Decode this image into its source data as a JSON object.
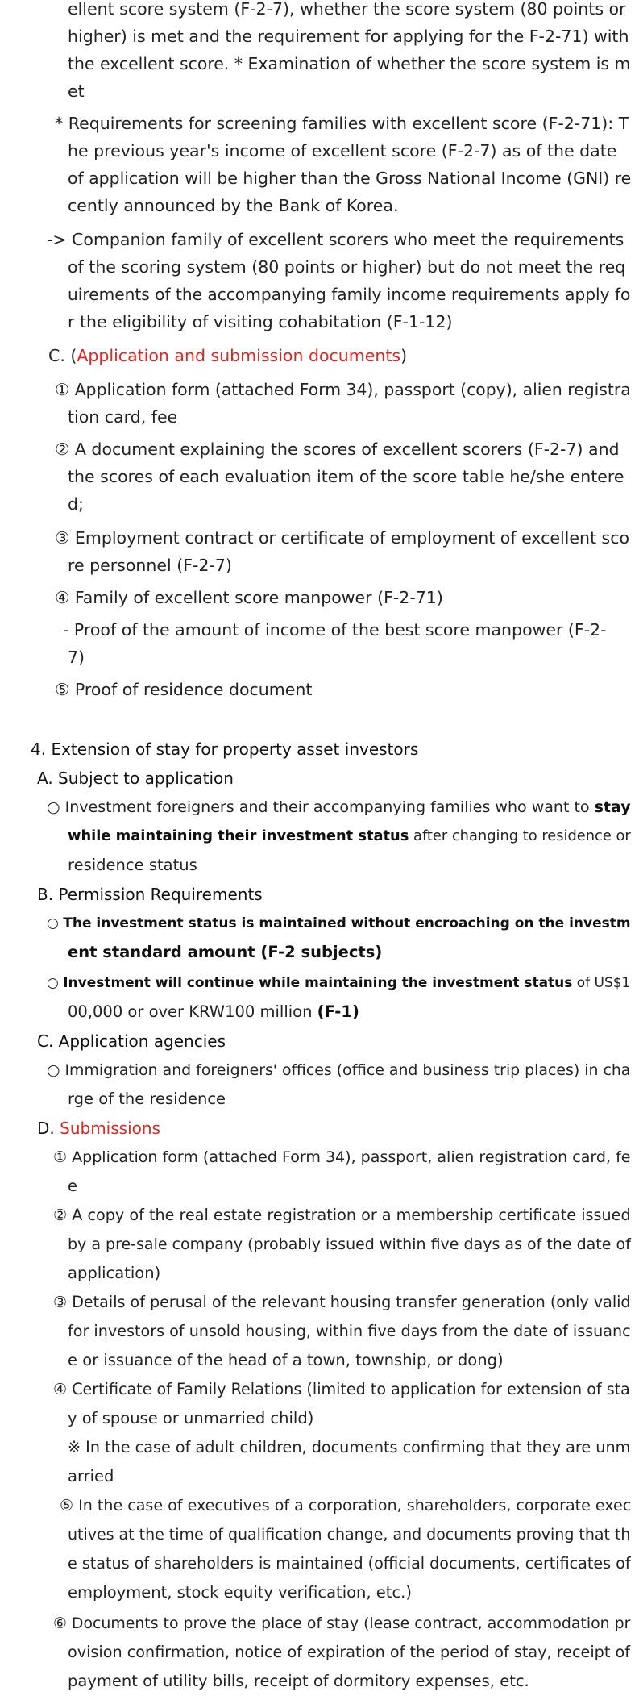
{
  "section3": {
    "p1": [
      "ellent score system (F-2-7), whether the score system (80 points or",
      "higher) is met and the requirement for applying for the F-2-71) with",
      "the excellent score. * Examination of whether the score system is m",
      "et"
    ],
    "p2": [
      "* Requirements for screening families with excellent score (F-2-71): T",
      "he previous year's income of excellent score (F-2-7) as of the date",
      "of application will be higher than the Gross National Income (GNI) re",
      "cently announced by the Bank of Korea."
    ],
    "p3": [
      "-> Companion family of excellent scorers who meet the requirements",
      "of the scoring system (80 points or higher) but do not meet the req",
      "uirements of the accompanying family income requirements apply fo",
      "r the eligibility of visiting cohabitation (F-1-12)"
    ],
    "c_prefix": "C. (",
    "c_title": "Application and submission documents",
    "c_suffix": ")",
    "i1": [
      "① Application form (attached Form 34), passport (copy), alien registra",
      "tion card, fee"
    ],
    "i2": [
      "② A document explaining the scores of excellent scorers (F-2-7) and",
      "the scores of each evaluation item of the score table he/she entere",
      "d;"
    ],
    "i3": [
      "③ Employment contract or certificate of employment of excellent sco",
      "re personnel (F-2-7)"
    ],
    "i4": "④ Family of excellent score manpower (F-2-71)",
    "i4_sub": [
      "- Proof of the amount of income of the best score manpower (F-2-",
      "7)"
    ],
    "i5": "⑤ Proof of residence document"
  },
  "section4": {
    "title": "4. Extension of stay for property asset investors",
    "a_title": "A. Subject to application",
    "a1_pre": "○ Investment foreigners and their accompanying families who want to ",
    "a1_bold1": "stay",
    "a1_bold2": "while maintaining their investment status",
    "a1_post": " after changing to residence or",
    "a1_line3": "residence status",
    "b_title": "B. Permission Requirements",
    "b1": [
      "The investment status is maintained without encroaching on the investm",
      "ent standard amount (F-2 subjects)"
    ],
    "b2_bold": "Investment will continue while maintaining the investment status",
    "b2_post": " of US$1",
    "b2_line2_pre": "00,000 or over KRW100 million ",
    "b2_line2_bold": "(F-1)",
    "bullet": "○ ",
    "c_title": "C. Application agencies",
    "c1": [
      "○ Immigration and foreigners' offices (office and business trip places) in cha",
      "rge of the residence"
    ],
    "d_prefix": "D. ",
    "d_title": "Submissions",
    "d1": [
      "① Application form (attached Form 34), passport, alien registration card, fe",
      "e"
    ],
    "d2": [
      "② A copy of the real estate registration or a membership certificate issued",
      "by a pre-sale company (probably issued within five days as of the date of",
      "application)"
    ],
    "d3": [
      "③ Details of perusal of the relevant housing transfer generation (only valid",
      "for investors of unsold housing, within five days from the date of issuanc",
      "e or issuance of the head of a town, township, or dong)"
    ],
    "d4": [
      "④ Certificate of Family Relations (limited to application for extension of sta",
      "y of spouse or unmarried child)"
    ],
    "d4_note": [
      "※ In the case of adult children, documents confirming that they are unm",
      "arried"
    ],
    "d5": [
      "⑤ In the case of executives of a corporation, shareholders, corporate exec",
      "utives at the time of qualification change, and documents proving that th",
      "e status of shareholders is maintained (official documents, certificates of",
      "employment, stock equity verification, etc.)"
    ],
    "d6": [
      "⑥ Documents to prove the place of stay (lease contract, accommodation pr",
      "ovision confirmation, notice of expiration of the period of stay, receipt of",
      "payment of utility bills, receipt of dormitory expenses, etc."
    ]
  }
}
